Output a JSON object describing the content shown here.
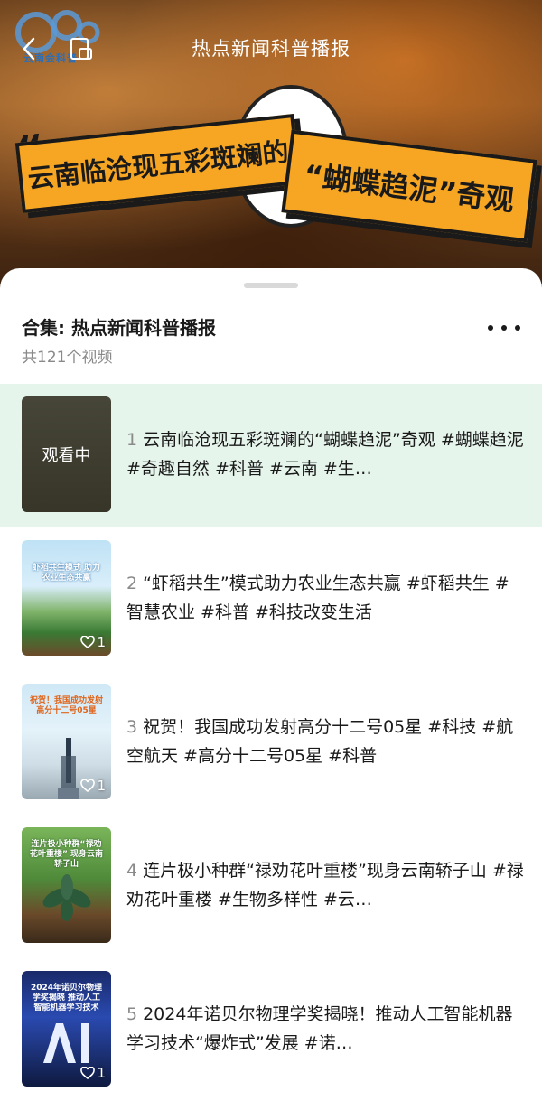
{
  "header": {
    "title": "热点新闻科普播报",
    "logo_text": "云南会科普"
  },
  "banner": {
    "left_text": "云南临沧现五彩斑斓的",
    "right_text": "“蝴蝶趋泥”奇观"
  },
  "collection": {
    "title": "合集: 热点新闻科普播报",
    "count": "共121个视频"
  },
  "items": [
    {
      "num": "1",
      "text": "云南临沧现五彩斑斓的“蝴蝶趋泥”奇观 #蝴蝶趋泥 #奇趣自然 #科普 #云南 #生…",
      "status": "观看中",
      "active": true
    },
    {
      "num": "2",
      "text": "“虾稻共生”模式助力农业生态共赢 #虾稻共生 #智慧农业 #科普 #科技改变生活",
      "likes": "1",
      "thumb_caption": "虾稻共生模式 助力农业生态共赢"
    },
    {
      "num": "3",
      "text": "祝贺！我国成功发射高分十二号05星 #科技 #航空航天 #高分十二号05星 #科普",
      "likes": "1",
      "thumb_caption": "祝贺！我国成功发射 高分十二号05星"
    },
    {
      "num": "4",
      "text": "连片极小种群“禄劝花叶重楼”现身云南轿子山 #禄劝花叶重楼 #生物多样性 #云…",
      "thumb_caption": "连片极小种群“禄劝花叶重楼” 现身云南轿子山"
    },
    {
      "num": "5",
      "text": "2024年诺贝尔物理学奖揭晓！推动人工智能机器学习技术“爆炸式”发展 #诺…",
      "likes": "1",
      "thumb_caption": "2024年诺贝尔物理学奖揭晓 推动人工智能机器学习技术"
    }
  ]
}
